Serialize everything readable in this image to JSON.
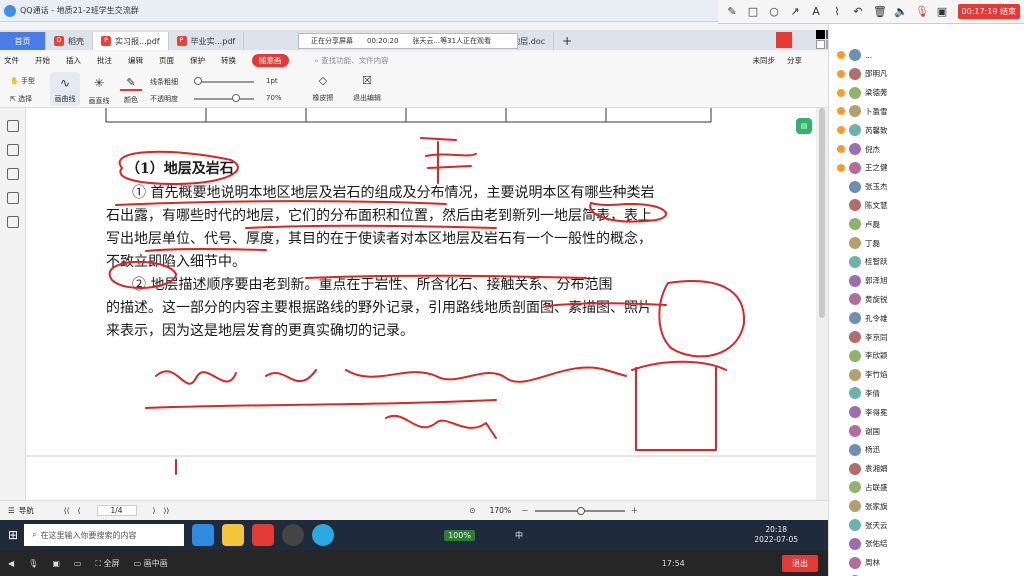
{
  "qq": {
    "title": "QQ通话 - 地质21-2班学生交流群"
  },
  "annotation_toolbar": {
    "tools": [
      "pen-icon",
      "rect-icon",
      "circle-icon",
      "arrow-icon",
      "text-icon",
      "highlighter-icon",
      "undo-icon",
      "delete-icon",
      "speaker-icon",
      "mic-off-icon",
      "camera-icon"
    ],
    "timer": "00:17:19 结束"
  },
  "tabs": [
    {
      "label": "首页",
      "kind": "home"
    },
    {
      "label": "稻壳",
      "kind": "pdf"
    },
    {
      "label": "实习报...pdf",
      "kind": "pdf",
      "active": true
    },
    {
      "label": "毕业实...pdf",
      "kind": "pdf"
    },
    {
      "label": "淮南地层.doc",
      "kind": "doc"
    }
  ],
  "share_bar": {
    "status": "正在分享屏幕",
    "time": "00:20:20",
    "viewers": "张天云...等31人正在观看"
  },
  "menu": {
    "file": "文件",
    "items": [
      "开始",
      "插入",
      "批注",
      "编辑",
      "页面",
      "保护",
      "转换"
    ],
    "active_pill": "随意画",
    "search_placeholder": "查找功能、文件内容",
    "sync": "未同步",
    "share": "分享"
  },
  "ribbon": {
    "hand": "手型",
    "select": "选择",
    "curve": "画曲线",
    "line": "画直线",
    "color": "颜色",
    "thickness_label": "线条粗细",
    "opacity_label": "不透明度",
    "thickness": "1pt",
    "opacity": "70%",
    "eraser": "橡皮擦",
    "exit": "退出编辑"
  },
  "document": {
    "heading": "（1）地层及岩石",
    "para1_lines": [
      "① 首先概要地说明本地区地层及岩石的组成及分布情况，主要说明本区有哪些种类岩",
      "石出露，有哪些时代的地层，它们的分布面积和位置，然后由老到新列一地层简表，表上",
      "写出地层单位、代号、厚度，其目的在于使读者对本区地层及岩石有一个一般性的概念，",
      "不致立即陷入细节中。"
    ],
    "para2_lines": [
      "② 地层描述顺序要由老到新。重点在于岩性、所含化石、接触关系、分布范围",
      "的描述。这一部分的内容主要根据路线的野外记录，引用路线地质剖面图、素描图、照片",
      "来表示，因为这是地层发育的更真实确切的记录。"
    ]
  },
  "status_bar": {
    "nav": "导航",
    "page": "1/4",
    "zoom": "170%"
  },
  "taskbar": {
    "search_placeholder": "在这里输入你要搜索的内容",
    "battery": "100%",
    "ime": "中",
    "time": "20:18",
    "date": "2022-07-05"
  },
  "bottom_controls": {
    "fullscreen": "全屏",
    "pip": "画中画",
    "time": "17:54",
    "exit": "退出"
  },
  "members": [
    "...",
    "邵明凡",
    "梁德莠",
    "卜盈雪",
    "芮馨致",
    "倪杰",
    "王之健",
    "张玉杰",
    "陈文慧",
    "卢磊",
    "丁磊",
    "桂智跃",
    "郭泽旭",
    "黄旋锐",
    "孔令雄",
    "李京同",
    "李欣颖",
    "李竹焰",
    "李倩",
    "李得冕",
    "谢国",
    "杨迅",
    "袁湘娟",
    "占联盛",
    "张家旗",
    "张天云",
    "张佑结",
    "周林",
    "朱佳佳"
  ],
  "colors": {
    "accent": "#e53935",
    "home_tab": "#4b7be5",
    "ink": "#d62828"
  }
}
